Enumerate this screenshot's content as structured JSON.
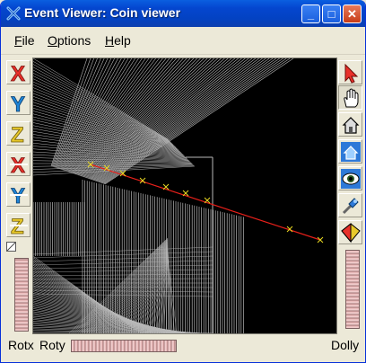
{
  "window": {
    "title": "Event Viewer: Coin viewer",
    "buttons": {
      "minimize": "_",
      "maximize": "□",
      "close": "✕"
    }
  },
  "menu": {
    "file": {
      "accel": "F",
      "rest": "ile"
    },
    "options": {
      "accel": "O",
      "rest": "ptions"
    },
    "help": {
      "accel": "H",
      "rest": "elp"
    }
  },
  "left_toolbar": {
    "icons": [
      "x-view-icon",
      "y-view-icon",
      "z-view-icon",
      "x-view-reverse-icon",
      "y-view-reverse-icon",
      "z-view-reverse-icon"
    ],
    "letters": [
      "X",
      "Y",
      "Z",
      "X",
      "Y",
      "Z"
    ],
    "colors": {
      "x": "#e8302a",
      "y": "#1f86d9",
      "z": "#e8c82a"
    }
  },
  "right_toolbar": {
    "icons": [
      "select-arrow-icon",
      "hand-icon",
      "home-icon",
      "set-home-icon",
      "view-all-icon",
      "seek-icon",
      "projection-icon"
    ]
  },
  "status": {
    "rotx": "Rotx",
    "roty": "Roty",
    "dolly": "Dolly"
  },
  "scene": {
    "background": "#000000",
    "geometry_color": "#b8b8b8",
    "track_color": "#e8201a",
    "marker_color": "#e8d820"
  }
}
